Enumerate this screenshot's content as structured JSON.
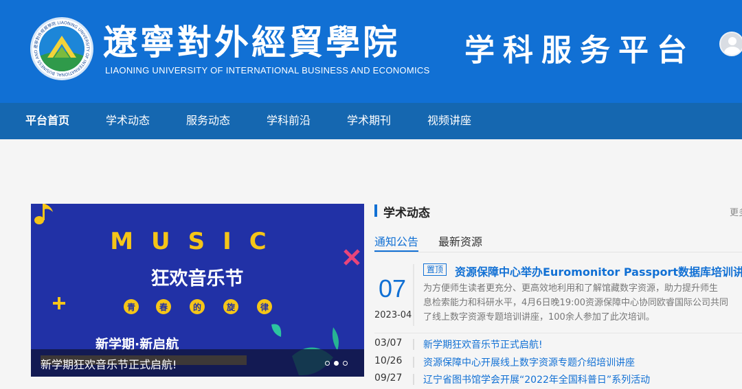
{
  "header": {
    "school_name_cn": "遼寧對外經貿學院",
    "school_name_en": "LIAONING UNIVERSITY OF INTERNATIONAL BUSINESS AND ECONOMICS",
    "platform_title": "学科服务平台",
    "logo_ring_text": "遼寧對外經貿學院 LIAONING UNIVERSITY OF INTERNATIONAL BUSINESS AND ECONOMICS"
  },
  "nav": {
    "items": [
      {
        "label": "平台首页",
        "active": true
      },
      {
        "label": "学术动态"
      },
      {
        "label": "服务动态"
      },
      {
        "label": "学科前沿"
      },
      {
        "label": "学术期刊"
      },
      {
        "label": "视频讲座"
      }
    ]
  },
  "banner": {
    "music": "MUSIC",
    "festival": "狂欢音乐节",
    "subtitle_chars": [
      "青",
      "春",
      "的",
      "旋",
      "律"
    ],
    "tagline": "新学期·新启航",
    "caption": "新学期狂欢音乐节正式启航!",
    "slide_count": 3,
    "active_slide": 1
  },
  "news_panel": {
    "title": "学术动态",
    "more": "更多",
    "tabs": [
      "通知公告",
      "最新资源"
    ],
    "featured": {
      "day": "07",
      "year_month": "2023-04",
      "badge": "置顶",
      "title": "资源保障中心举办Euromonitor Passport数据库培训讲座",
      "desc_lines": [
        "为方便师生读者更充分、更高效地利用和了解馆藏数字资源，助力提升师生",
        "息检索能力和科研水平，4月6日晚19:00资源保障中心协同欧睿国际公司共同",
        "了线上数字资源专题培训讲座，100余人参加了此次培训。"
      ]
    },
    "items": [
      {
        "date": "03/07",
        "title": "新学期狂欢音乐节正式启航!"
      },
      {
        "date": "10/26",
        "title": "资源保障中心开展线上数字资源专题介绍培训讲座"
      },
      {
        "date": "09/27",
        "title": "辽宁省图书馆学会开展“2022年全国科普日”系列活动"
      }
    ]
  },
  "colors": {
    "header_bg": "#1170d4",
    "nav_bg": "#1567b0",
    "accent": "#1170d4",
    "banner_bg": "#2131a6",
    "banner_yellow": "#f5c518"
  }
}
